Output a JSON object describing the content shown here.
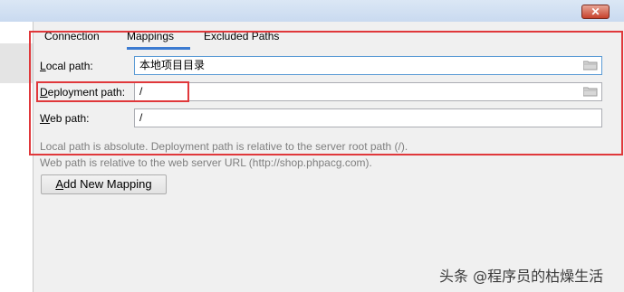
{
  "window": {
    "close_glyph": "✕"
  },
  "tabs": [
    {
      "label": "Connection",
      "active": false
    },
    {
      "label": "Mappings",
      "active": true
    },
    {
      "label": "Excluded Paths",
      "active": false
    }
  ],
  "form": {
    "local_path": {
      "label_mnemonic": "L",
      "label_rest": "ocal path:",
      "value": "本地项目目录",
      "icon": "folder-icon"
    },
    "deployment_path": {
      "label_mnemonic": "D",
      "label_rest": "eployment path:",
      "value": "/",
      "icon": "folder-icon"
    },
    "web_path": {
      "label_mnemonic": "W",
      "label_rest": "eb path:",
      "value": "/"
    }
  },
  "hints": {
    "line1": "Local path is absolute. Deployment path is relative to the server root path (/).",
    "line2": "Web path is relative to the web server URL (http://shop.phpacg.com)."
  },
  "add_button": {
    "mnemonic": "A",
    "label_rest": "dd New Mapping"
  },
  "watermark": "头条 @程序员的枯燥生活",
  "colors": {
    "annotation": "#e0383b",
    "active_tab": "#3c7bd1",
    "hint_text": "#7f7f7f"
  }
}
